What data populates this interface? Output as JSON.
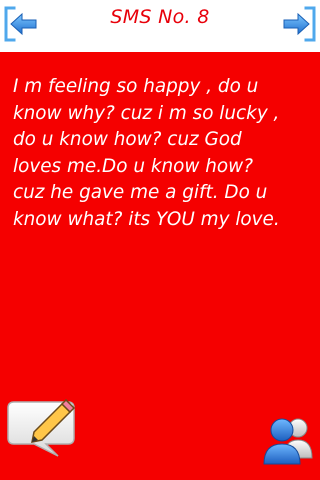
{
  "header": {
    "title": "SMS No. 8",
    "prev_icon": "arrow-left-icon",
    "next_icon": "arrow-right-icon"
  },
  "message": {
    "lines": [
      "I m feeling so happy  , do u",
      "know why? cuz i m so lucky  ,",
      "do u know how? cuz God",
      "loves me.Do u know how?",
      "cuz he gave me a gift. Do u",
      "know what? its YOU my love."
    ]
  },
  "footer": {
    "compose_icon": "compose-sms-icon",
    "contacts_icon": "contacts-icon"
  },
  "colors": {
    "background": "#f50000",
    "header_background": "#ffffff",
    "title": "#e8000a",
    "message_text": "#ffffff",
    "nav_arrow": "#2a7fd6"
  }
}
